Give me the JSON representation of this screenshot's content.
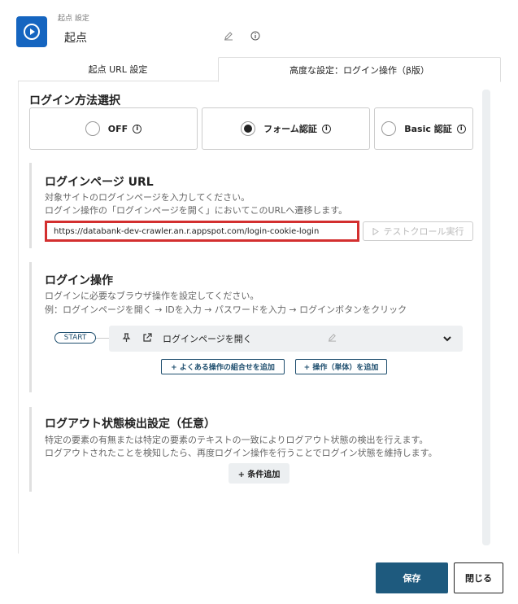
{
  "header": {
    "label": "起点 設定",
    "title": "起点",
    "accent": "#1565c0"
  },
  "tabs": [
    {
      "label": "起点 URL 設定"
    },
    {
      "label": "高度な設定：ログイン操作（β版）"
    }
  ],
  "login_method": {
    "title": "ログイン方法選択",
    "options": [
      {
        "label": "OFF",
        "selected": false
      },
      {
        "label": "フォーム認証",
        "selected": true
      },
      {
        "label": "Basic 認証",
        "selected": false
      }
    ]
  },
  "login_page": {
    "title": "ログインページ URL",
    "desc1": "対象サイトのログインページを入力してください。",
    "desc2": "ログイン操作の「ログインページを開く」においてこのURLへ遷移します。",
    "url_value": "https://databank-dev-crawler.an.r.appspot.com/login-cookie-login",
    "test_button": "テストクロール実行"
  },
  "login_ops": {
    "title": "ログイン操作",
    "desc1": "ログインに必要なブラウザ操作を設定してください。",
    "desc2": "例：ログインページを開く → IDを入力 → パスワードを入力 → ログインボタンをクリック",
    "start_label": "START",
    "step_label": "ログインページを開く",
    "add_combo": "+ よくある操作の組合せを追加",
    "add_single": "+ 操作（単体）を追加"
  },
  "logout": {
    "title": "ログアウト状態検出設定（任意）",
    "desc1": "特定の要素の有無または特定の要素のテキストの一致によりログアウト状態の検出を行えます。",
    "desc2": "ログアウトされたことを検知したら、再度ログイン操作を行うことでログイン状態を維持します。",
    "add_condition": "+ 条件追加"
  },
  "footer": {
    "save": "保存",
    "close": "閉じる",
    "save_color": "#1e5a7e"
  }
}
